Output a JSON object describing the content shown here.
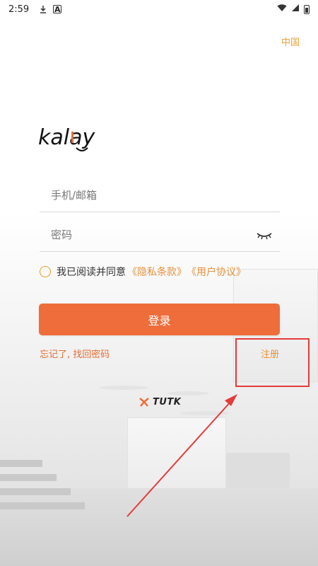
{
  "status_bar": {
    "time": "2:59",
    "icons": [
      "download-icon",
      "a-box-icon",
      "wifi-icon",
      "signal-icon",
      "battery-icon"
    ]
  },
  "region": {
    "label": "中国"
  },
  "logo": {
    "text": "kalay"
  },
  "login_form": {
    "account_placeholder": "手机/邮箱",
    "password_placeholder": "密码",
    "agree_text": "我已阅读并同意",
    "privacy_link": "《隐私条款》",
    "user_agreement_link": "《用户协议》",
    "login_button": "登录",
    "forgot_link": "忘记了, 找回密码",
    "register_link": "注册"
  },
  "footer": {
    "brand": "TUTK"
  },
  "colors": {
    "accent": "#ee6d3a",
    "link": "#e8913a",
    "highlight": "#e43b3b"
  }
}
